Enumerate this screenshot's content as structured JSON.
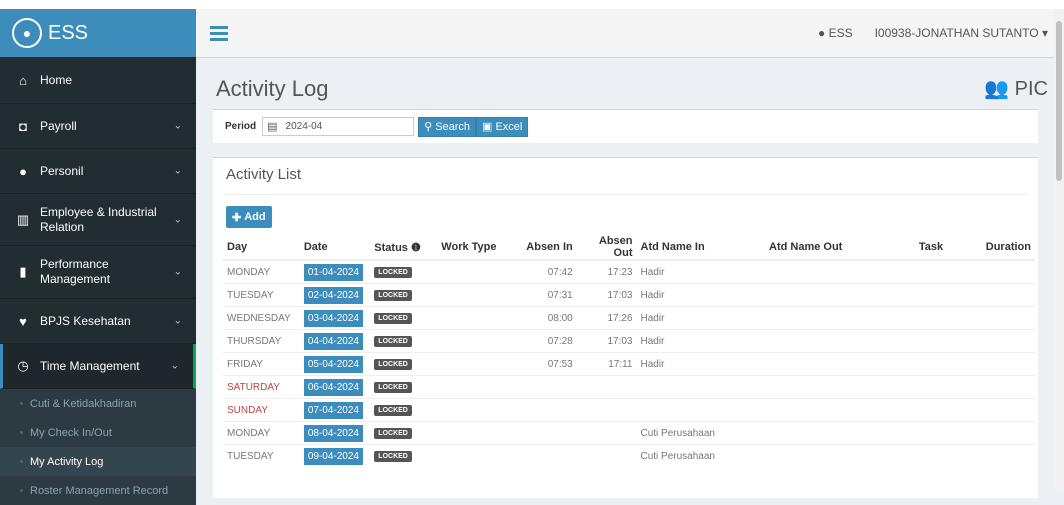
{
  "app": {
    "brand": "ESS"
  },
  "sidebar": {
    "items": [
      {
        "label": "Home",
        "icon": "home-icon",
        "glyph": "⌂",
        "has_chevron": false
      },
      {
        "label": "Payroll",
        "icon": "money-icon",
        "glyph": "◘",
        "has_chevron": true
      },
      {
        "label": "Personil",
        "icon": "user-icon",
        "glyph": "●",
        "has_chevron": true
      },
      {
        "label": "Employee & Industrial Relation",
        "icon": "bank-icon",
        "glyph": "▥",
        "has_chevron": true
      },
      {
        "label": "Performance Management",
        "icon": "bar-chart-icon",
        "glyph": "▮",
        "has_chevron": true
      },
      {
        "label": "BPJS Kesehatan",
        "icon": "heart-icon",
        "glyph": "♥",
        "has_chevron": true
      },
      {
        "label": "Time Management",
        "icon": "clock-icon",
        "glyph": "◷",
        "has_chevron": true
      }
    ],
    "sub_items": [
      "Cuti & Ketidakhadiran",
      "My Check In/Out",
      "My Activity Log",
      "Roster Management Record"
    ]
  },
  "navbar": {
    "user_short": "ESS",
    "user_full": "I00938-JONATHAN SUTANTO"
  },
  "page": {
    "title": "Activity Log",
    "pic_label": "PIC"
  },
  "filter": {
    "period_label": "Period",
    "period_value": "2024-04",
    "search_label": "Search",
    "excel_label": "Excel"
  },
  "activity": {
    "title": "Activity List",
    "add_label": "Add",
    "columns": [
      "Day",
      "Date",
      "Status",
      "Work Type",
      "Absen In",
      "Absen Out",
      "Atd Name In",
      "Atd Name Out",
      "Task",
      "Duration"
    ],
    "rows": [
      {
        "day": "MONDAY",
        "date": "01-04-2024",
        "status": "LOCKED",
        "absen_in": "07:42",
        "absen_out": "17:23",
        "atd_in": "Hadir",
        "weekend": false
      },
      {
        "day": "TUESDAY",
        "date": "02-04-2024",
        "status": "LOCKED",
        "absen_in": "07:31",
        "absen_out": "17:03",
        "atd_in": "Hadir",
        "weekend": false
      },
      {
        "day": "WEDNESDAY",
        "date": "03-04-2024",
        "status": "LOCKED",
        "absen_in": "08:00",
        "absen_out": "17:26",
        "atd_in": "Hadir",
        "weekend": false
      },
      {
        "day": "THURSDAY",
        "date": "04-04-2024",
        "status": "LOCKED",
        "absen_in": "07:28",
        "absen_out": "17:03",
        "atd_in": "Hadir",
        "weekend": false
      },
      {
        "day": "FRIDAY",
        "date": "05-04-2024",
        "status": "LOCKED",
        "absen_in": "07:53",
        "absen_out": "17:11",
        "atd_in": "Hadir",
        "weekend": false
      },
      {
        "day": "SATURDAY",
        "date": "06-04-2024",
        "status": "LOCKED",
        "absen_in": "",
        "absen_out": "",
        "atd_in": "",
        "weekend": true
      },
      {
        "day": "SUNDAY",
        "date": "07-04-2024",
        "status": "LOCKED",
        "absen_in": "",
        "absen_out": "",
        "atd_in": "",
        "weekend": true
      },
      {
        "day": "MONDAY",
        "date": "08-04-2024",
        "status": "LOCKED",
        "absen_in": "",
        "absen_out": "",
        "atd_in": "Cuti Perusahaan",
        "weekend": false
      },
      {
        "day": "TUESDAY",
        "date": "09-04-2024",
        "status": "LOCKED",
        "absen_in": "",
        "absen_out": "",
        "atd_in": "Cuti Perusahaan",
        "weekend": false
      }
    ]
  }
}
